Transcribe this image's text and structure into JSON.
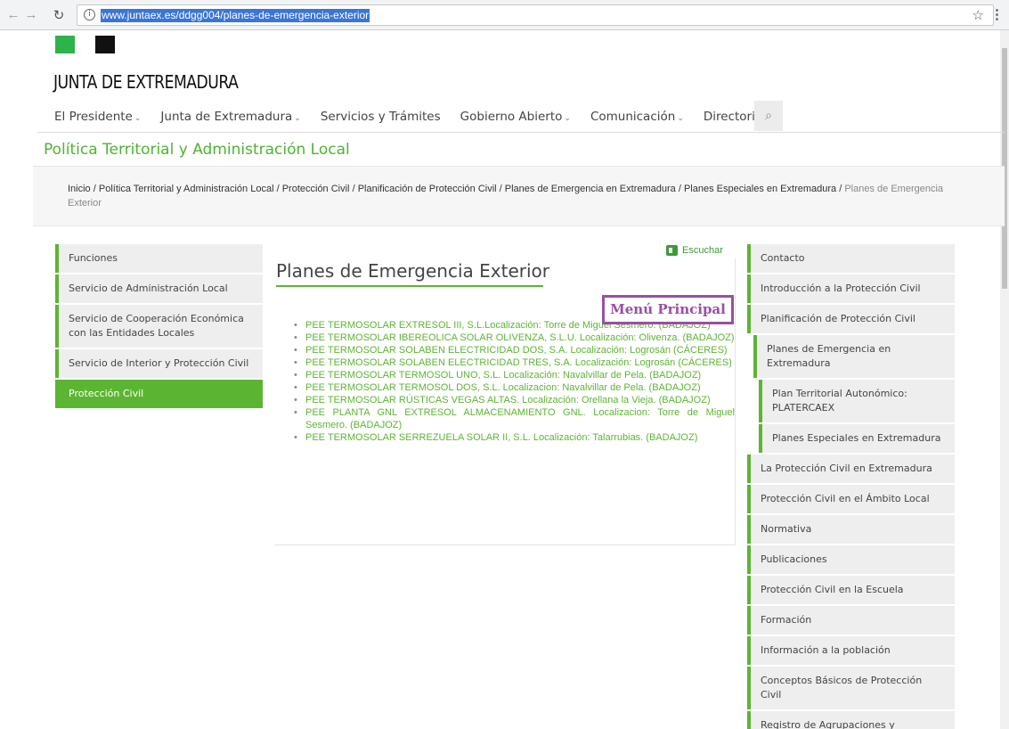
{
  "browser": {
    "url": "www.juntaex.es/ddgg004/planes-de-emergencia-exterior",
    "back_icon": "back-arrow-icon",
    "forward_icon": "forward-arrow-icon",
    "reload_icon": "reload-icon",
    "info_icon": "info-icon",
    "bookmark_icon": "star-icon",
    "menu_icon": "kebab-menu-icon"
  },
  "header": {
    "logo_text": "JUNTA DE EXTREMADURA",
    "nav": [
      {
        "label": "El Presidente",
        "dropdown": true
      },
      {
        "label": "Junta de Extremadura",
        "dropdown": true
      },
      {
        "label": "Servicios y Trámites",
        "dropdown": false
      },
      {
        "label": "Gobierno Abierto",
        "dropdown": true
      },
      {
        "label": "Comunicación",
        "dropdown": true
      },
      {
        "label": "Directorio",
        "dropdown": false
      }
    ],
    "chevron": "⌄",
    "search_glyph": "🔍",
    "section_title": "Política Territorial y Administración Local"
  },
  "breadcrumb": {
    "items": [
      "Inicio",
      "Política Territorial y Administración Local",
      "Protección Civil",
      "Planificación de Protección Civil",
      "Planes de Emergencia en Extremadura",
      "Planes Especiales en Extremadura"
    ],
    "separator": " / ",
    "current": "Planes de Emergencia Exterior"
  },
  "left_menu": [
    {
      "label": "Funciones",
      "active": false
    },
    {
      "label": "Servicio de Administración Local",
      "active": false
    },
    {
      "label": "Servicio de Cooperación Económica con las Entidades Locales",
      "active": false
    },
    {
      "label": "Servicio de Interior y Protección Civil",
      "active": false
    },
    {
      "label": "Protección Civil",
      "active": true
    }
  ],
  "main": {
    "escuchar": "Escuchar",
    "title": "Planes de Emergencia Exterior",
    "annotation": "Menú Principal",
    "plans": [
      "PEE TERMOSOLAR EXTRESOL III, S.L.Localización: Torre de Miguel Sesmero. (BADAJOZ)",
      "PEE TERMOSOLAR IBEREOLICA SOLAR OLIVENZA, S.L.U. Localización: Olivenza. (BADAJOZ)",
      "PEE TERMOSOLAR SOLABEN ELECTRICIDAD DOS, S.A. Localización: Logrosán (CÁCERES)",
      "PEE TERMOSOLAR SOLABEN ELECTRICIDAD TRES, S.A. Localización: Logrosán (CÁCERES)",
      "PEE TERMOSOLAR TERMOSOL UNO, S.L. Localización: Navalvillar de Pela. (BADAJOZ)",
      "PEE TERMOSOLAR TERMOSOL DOS, S.L. Localizacion: Navalvillar de Pela. (BADAJOZ)",
      "PEE TERMOSOLAR RÚSTICAS VEGAS ALTAS. Localización: Orellana la Vieja. (BADAJOZ)",
      "PEE PLANTA GNL EXTRESOL ALMACENAMIENTO GNL. Localizacion: Torre de Miguel Sesmero. (BADAJOZ)",
      "PEE TERMOSOLAR SERREZUELA SOLAR II, S.L. Localización: Talarrubias. (BADAJOZ)"
    ]
  },
  "right_menu": [
    {
      "label": "Contacto",
      "level": 0
    },
    {
      "label": "Introducción a la Protección Civil",
      "level": 0
    },
    {
      "label": "Planificación de Protección Civil",
      "level": 0
    },
    {
      "label": "Planes de Emergencia en Extremadura",
      "level": 1
    },
    {
      "label": "Plan Territorial Autonómico: PLATERCAEX",
      "level": 2
    },
    {
      "label": "Planes Especiales en Extremadura",
      "level": 2
    },
    {
      "label": "La Protección Civil en Extremadura",
      "level": 0
    },
    {
      "label": "Protección Civil en el Ámbito Local",
      "level": 0
    },
    {
      "label": "Normativa",
      "level": 0
    },
    {
      "label": "Publicaciones",
      "level": 0
    },
    {
      "label": "Protección Civil en la Escuela",
      "level": 0
    },
    {
      "label": "Formación",
      "level": 0
    },
    {
      "label": "Información a la población",
      "level": 0
    },
    {
      "label": "Conceptos Básicos de Protección Civil",
      "level": 0
    },
    {
      "label": "Registro de Agrupaciones y Asociaciones",
      "level": 0
    }
  ],
  "colors": {
    "brand_green": "#5cb532",
    "annotation_purple": "#9c4ea4",
    "logo_black": "#111111"
  }
}
